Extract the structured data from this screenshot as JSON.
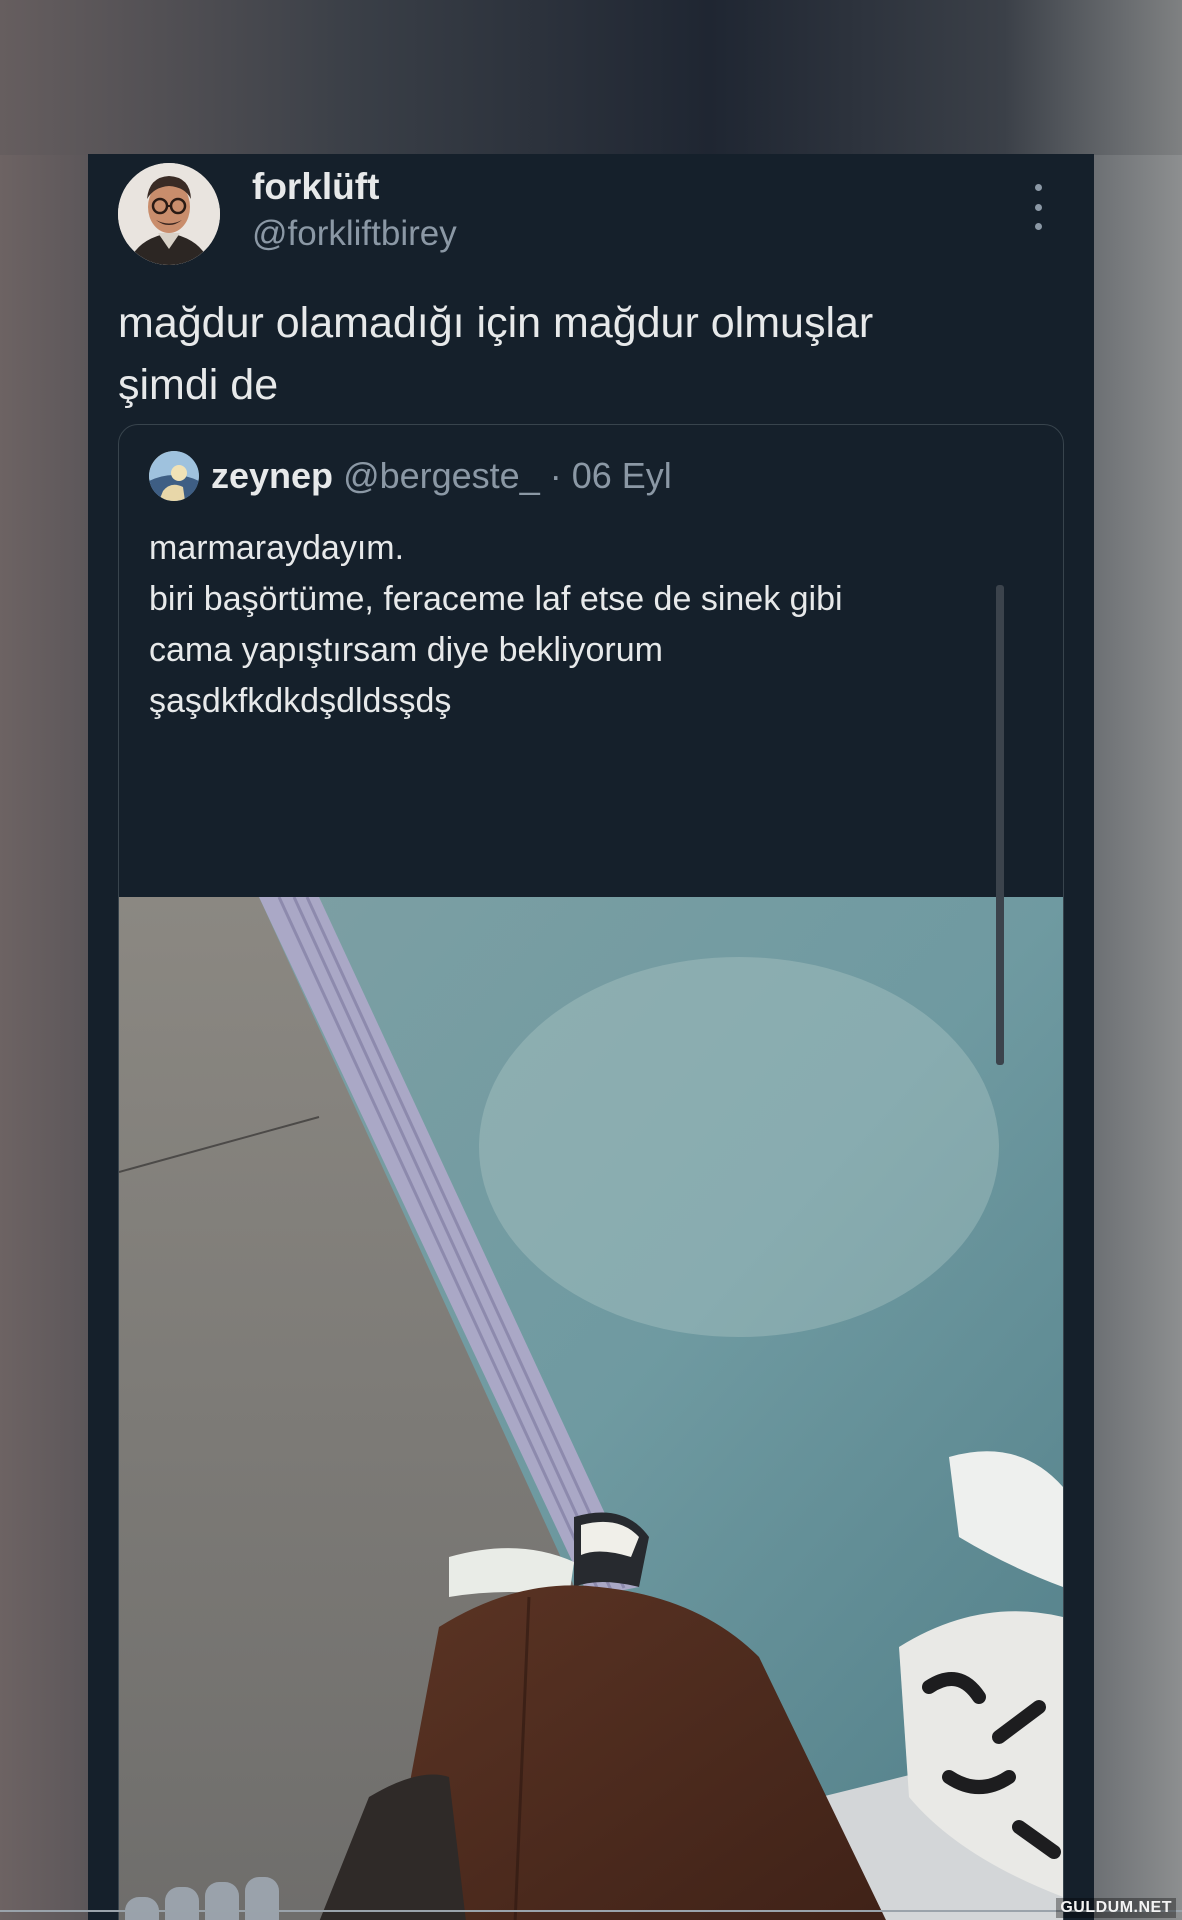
{
  "tweet": {
    "author_name": "forklüft",
    "author_handle": "@forkliftbirey",
    "text": "mağdur olamadığı için mağdur olmuşlar\nşimdi de",
    "more_icon": "more-vertical-icon"
  },
  "quoted_tweet": {
    "author_name": "zeynep",
    "author_handle": "@bergeste_",
    "date": "· 06 Eyl",
    "text": "marmaraydayım.\nbiri başörtüme, feraceme laf etse de sinek gibi\ncama yapıştırsam diye bekliyorum\nşaşdkfkdkdşdldsşdş"
  },
  "watermark": "GULDUM.NET",
  "colors": {
    "card_bg": "#15202b",
    "primary_text": "#e7e9ea",
    "secondary_text": "#8b98a5",
    "border": "#38444d"
  }
}
